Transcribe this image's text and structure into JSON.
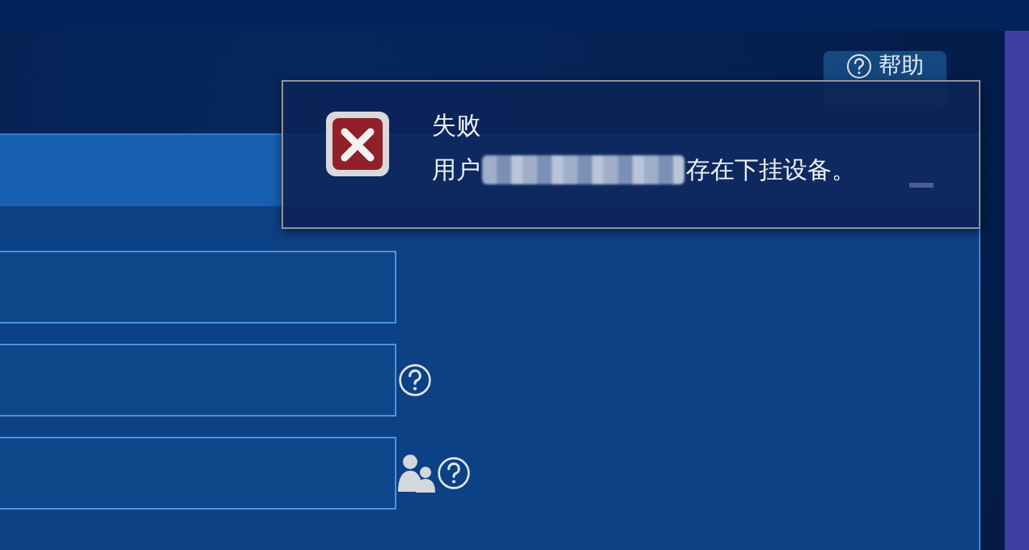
{
  "help_button": {
    "label": "帮助"
  },
  "form": {
    "fields": [
      {
        "kind": "plain"
      },
      {
        "kind": "help"
      },
      {
        "kind": "users-help"
      }
    ]
  },
  "dialog": {
    "title": "失败",
    "message_prefix": "用户",
    "redacted": true,
    "message_suffix": "存在下挂设备。",
    "kind": "error"
  }
}
